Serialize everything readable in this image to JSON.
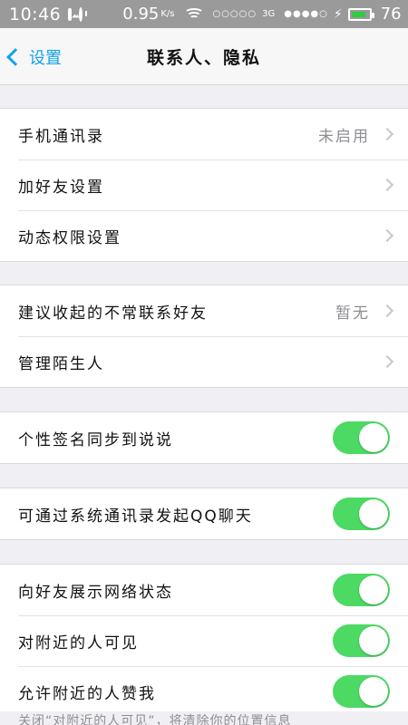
{
  "statusbar": {
    "time": "10:46",
    "speed": "0.95",
    "speed_unit": "K/s",
    "dots": "○○○○○",
    "network": "3G",
    "signal_dots": "●●●●○",
    "battery": "76",
    "battery_color": "#2ecc40"
  },
  "nav": {
    "back_label": "设置",
    "title": "联系人、隐私"
  },
  "groups": [
    {
      "rows": [
        {
          "label": "手机通讯录",
          "value": "未启用",
          "type": "link"
        },
        {
          "label": "加好友设置",
          "value": "",
          "type": "link"
        },
        {
          "label": "动态权限设置",
          "value": "",
          "type": "link"
        }
      ]
    },
    {
      "rows": [
        {
          "label": "建议收起的不常联系好友",
          "value": "暂无",
          "type": "link"
        },
        {
          "label": "管理陌生人",
          "value": "",
          "type": "link"
        }
      ]
    },
    {
      "rows": [
        {
          "label": "个性签名同步到说说",
          "type": "toggle",
          "on": true
        }
      ]
    },
    {
      "rows": [
        {
          "label": "可通过系统通讯录发起QQ聊天",
          "type": "toggle",
          "on": true
        }
      ]
    },
    {
      "rows": [
        {
          "label": "向好友展示网络状态",
          "type": "toggle",
          "on": true
        },
        {
          "label": "对附近的人可见",
          "type": "toggle",
          "on": true
        },
        {
          "label": "允许附近的人赞我",
          "type": "toggle",
          "on": true
        }
      ]
    }
  ],
  "footer_text": "关闭“对附近的人可见”，将清除你的位置信息",
  "colors": {
    "accent": "#12a3ea",
    "toggle_on": "#4cd964"
  }
}
